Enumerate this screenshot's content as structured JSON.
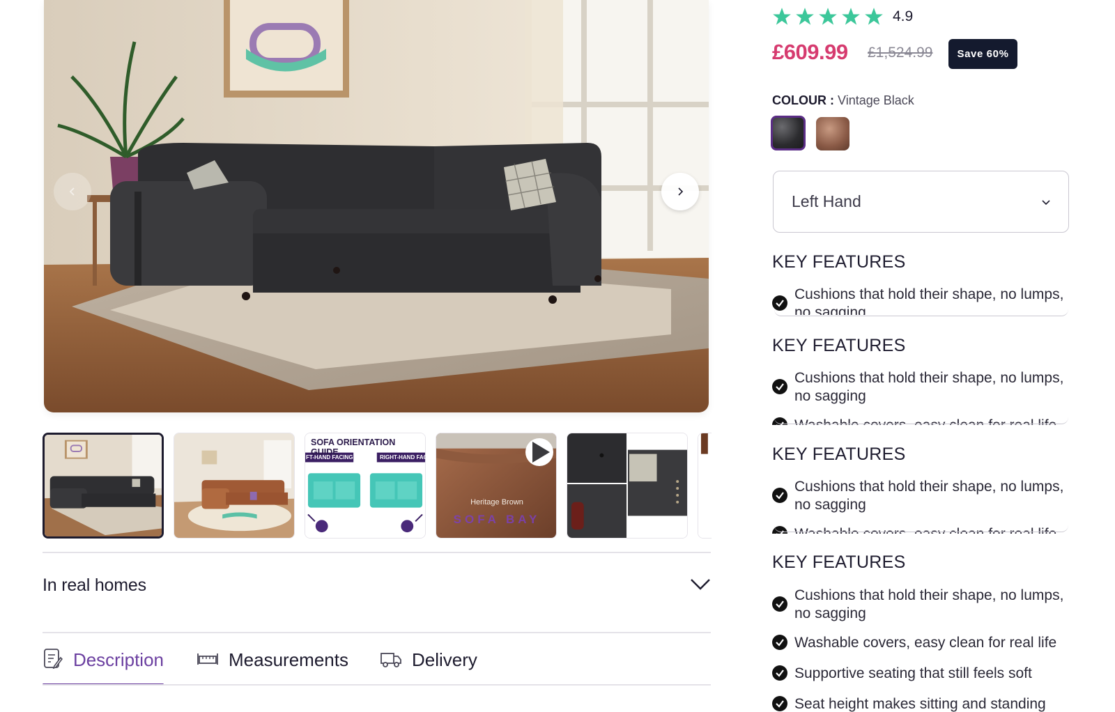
{
  "gallery": {
    "main_image_alt": "",
    "prev_icon": "chevron-left-icon",
    "next_icon": "chevron-right-icon",
    "thumbnails": [
      {
        "id": "thumb-black-sofa",
        "caption": ""
      },
      {
        "id": "thumb-brown-sofa",
        "caption": ""
      },
      {
        "id": "thumb-orientation-guide",
        "title": "SOFA ORIENTATION GUIDE",
        "left_label": "FT-HAND FACING",
        "right_label": "RIGHT-HAND FAC"
      },
      {
        "id": "thumb-video",
        "caption": "Heritage Brown",
        "watermark": "SOFA BAY"
      },
      {
        "id": "thumb-detail",
        "caption": ""
      }
    ]
  },
  "accordion": {
    "title": "In real homes"
  },
  "tabs": [
    {
      "label": "Description",
      "icon": "document-edit-icon",
      "active": true
    },
    {
      "label": "Measurements",
      "icon": "ruler-icon",
      "active": false
    },
    {
      "label": "Delivery",
      "icon": "truck-icon",
      "active": false
    }
  ],
  "product": {
    "rating": "4.9",
    "stars": 5,
    "price": "£609.99",
    "old_price": "£1,524.99",
    "save_badge": "Save 60%",
    "colour_label": "COLOUR :",
    "colour_value": "Vintage Black",
    "swatches": [
      "Vintage Black",
      "Heritage Brown"
    ],
    "orientation_select": "Left Hand"
  },
  "key_features": {
    "heading": "KEY FEATURES",
    "items": [
      "Cushions that hold their shape, no lumps, no sagging",
      "Washable covers, easy clean for real life",
      "Supportive seating that still feels soft",
      "Seat height makes sitting and standing"
    ]
  },
  "colors": {
    "accent_purple": "#6b3fa0",
    "price_pink": "#d63b6f",
    "badge_navy": "#141a2e",
    "star_green": "#3cc79a"
  }
}
